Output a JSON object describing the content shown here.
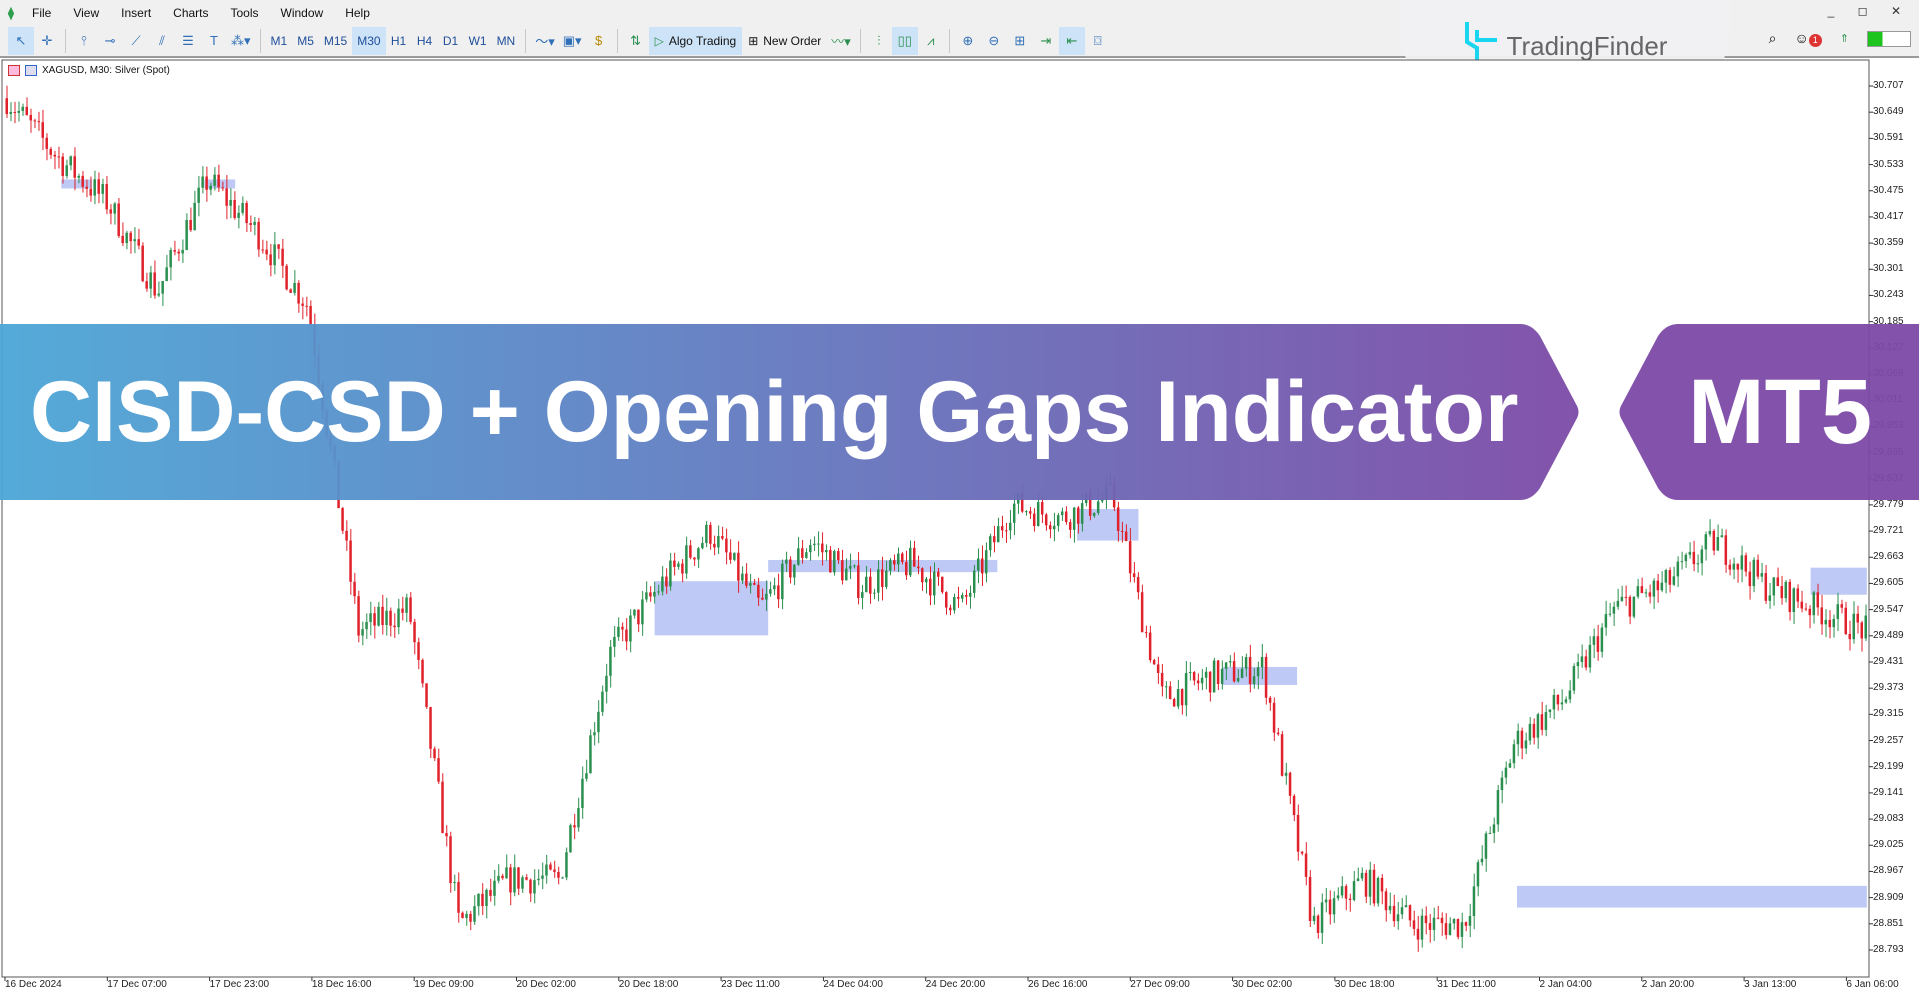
{
  "menu": {
    "items": [
      "File",
      "View",
      "Insert",
      "Charts",
      "Tools",
      "Window",
      "Help"
    ]
  },
  "toolbar": {
    "timeframes": [
      "M1",
      "M5",
      "M15",
      "M30",
      "H1",
      "H4",
      "D1",
      "W1",
      "MN"
    ],
    "active_timeframe": "M30",
    "algo_trading": "Algo Trading",
    "new_order": "New Order",
    "notification_count": "1"
  },
  "logo": {
    "text": "TradingFinder"
  },
  "chart": {
    "title": "XAGUSD, M30:  Silver (Spot)"
  },
  "banner": {
    "title": "CISD-CSD + Opening Gaps Indicator",
    "platform": "MT5",
    "colors": {
      "start": "#4ba6d6",
      "end": "#7c4aa6"
    }
  },
  "chart_data": {
    "type": "candlestick",
    "symbol": "XAGUSD",
    "timeframe": "M30",
    "colors": {
      "bull": "#2a8f4e",
      "bear": "#e0202a",
      "gap_zone": "#b7c3f5"
    },
    "y_ticks": [
      "30.707",
      "30.649",
      "30.591",
      "30.533",
      "30.475",
      "30.417",
      "30.359",
      "30.301",
      "30.243",
      "30.185",
      "30.127",
      "30.069",
      "30.011",
      "29.953",
      "29.895",
      "29.837",
      "29.779",
      "29.721",
      "29.663",
      "29.605",
      "29.547",
      "29.489",
      "29.431",
      "29.373",
      "29.315",
      "29.257",
      "29.199",
      "29.141",
      "29.083",
      "29.025",
      "28.967",
      "28.909",
      "28.851",
      "28.793"
    ],
    "ylim": [
      28.77,
      30.75
    ],
    "x_ticks": [
      "16 Dec 2024",
      "17 Dec 07:00",
      "17 Dec 23:00",
      "18 Dec 16:00",
      "19 Dec 09:00",
      "20 Dec 02:00",
      "20 Dec 18:00",
      "23 Dec 11:00",
      "24 Dec 04:00",
      "24 Dec 20:00",
      "26 Dec 16:00",
      "27 Dec 09:00",
      "30 Dec 02:00",
      "30 Dec 18:00",
      "31 Dec 11:00",
      "2 Jan 04:00",
      "2 Jan 20:00",
      "3 Jan 13:00",
      "6 Jan 06:00"
    ],
    "approx_close_path": [
      30.68,
      30.55,
      30.45,
      30.25,
      30.5,
      30.38,
      30.22,
      29.5,
      29.55,
      28.85,
      28.95,
      28.95,
      29.45,
      29.6,
      29.72,
      29.55,
      29.7,
      29.6,
      29.65,
      29.55,
      29.78,
      29.75,
      29.8,
      29.35,
      29.4,
      29.42,
      28.85,
      28.95,
      28.85,
      28.85,
      29.25,
      29.35,
      29.55,
      29.6,
      29.7,
      29.6,
      29.55,
      29.5
    ],
    "gap_zones": [
      {
        "from_tick": 0.55,
        "to_tick": 0.85,
        "low": 30.48,
        "high": 30.5
      },
      {
        "from_tick": 1.95,
        "to_tick": 2.25,
        "low": 30.48,
        "high": 30.5
      },
      {
        "from_tick": 6.35,
        "to_tick": 7.46,
        "low": 29.49,
        "high": 29.61
      },
      {
        "from_tick": 7.46,
        "to_tick": 9.7,
        "low": 29.63,
        "high": 29.657
      },
      {
        "from_tick": 10.48,
        "to_tick": 11.08,
        "low": 29.7,
        "high": 29.77
      },
      {
        "from_tick": 11.9,
        "to_tick": 12.63,
        "low": 29.38,
        "high": 29.42
      },
      {
        "from_tick": 14.78,
        "to_tick": 18.2,
        "low": 28.887,
        "high": 28.935
      },
      {
        "from_tick": 17.65,
        "to_tick": 18.2,
        "low": 29.58,
        "high": 29.64
      }
    ]
  }
}
